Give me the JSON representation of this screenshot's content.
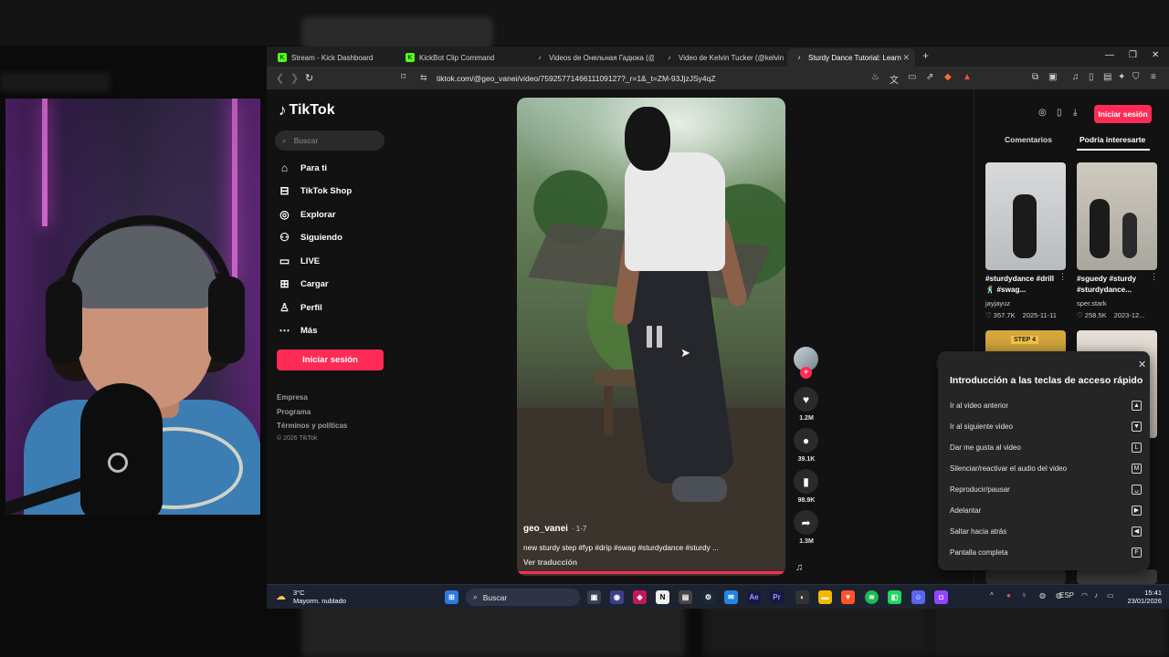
{
  "browser": {
    "tabs": [
      {
        "label": "Stream - Kick Dashboard",
        "icon": "kick-icon",
        "color": "#53fc18"
      },
      {
        "label": "KickBot Clip Command",
        "icon": "kick-icon",
        "color": "#53fc18"
      },
      {
        "label": "Videos de Онельная Гадюка (@gora",
        "icon": "tiktok-icon",
        "color": "#ffffff"
      },
      {
        "label": "Video de Kelvin Tucker (@kelvinkelvi",
        "icon": "tiktok-icon",
        "color": "#ffffff"
      },
      {
        "label": "Sturdy Dance Tutorial: Learn",
        "icon": "tiktok-icon",
        "color": "#ffffff",
        "active": true
      }
    ],
    "url": "tiktok.com/@geo_vanei/video/7592577146611109127?_r=1&_t=ZM-93JjzJSy4qZ"
  },
  "tiktok": {
    "logo_text": "TikTok",
    "search_placeholder": "Buscar",
    "menu": [
      {
        "label": "Para ti",
        "icon": "home-icon"
      },
      {
        "label": "TikTok Shop",
        "icon": "shop-icon"
      },
      {
        "label": "Explorar",
        "icon": "compass-icon"
      },
      {
        "label": "Siguiendo",
        "icon": "following-icon"
      },
      {
        "label": "LIVE",
        "icon": "live-icon"
      },
      {
        "label": "Cargar",
        "icon": "upload-icon"
      },
      {
        "label": "Perfil",
        "icon": "profile-icon"
      },
      {
        "label": "Más",
        "icon": "more-icon"
      }
    ],
    "login_label": "Iniciar sesión",
    "footer": {
      "links": [
        "Empresa",
        "Programa",
        "Términos y políticas"
      ],
      "copyright": "© 2026 TikTok"
    },
    "accent": "#fe2c55"
  },
  "video": {
    "author": "geo_vanei",
    "date": "· 1-7",
    "description": "new sturdy step #fyp #drip #swag #sturdydance #sturdy ...",
    "translate": "Ver traducción",
    "counts": {
      "likes": "1.2M",
      "comments": "39.1K",
      "saves": "98.9K",
      "shares": "1.3M"
    }
  },
  "right_panel": {
    "login_label": "Iniciar sesión",
    "tabs": [
      "Comentarios",
      "Podría interesarte"
    ],
    "suggestions": [
      {
        "caption": "#sturdydance #drill 🕺 #swag...",
        "author": "jayjayuz",
        "likes": "♡ 357.7K",
        "date": "2025-11-11"
      },
      {
        "caption": "#sguedy #sturdy #sturdydance...",
        "author": "sper.stark",
        "likes": "♡ 258.5K",
        "date": "2023-12..."
      }
    ],
    "thumb3_tag": "STEP 4"
  },
  "shortcuts": {
    "title": "Introducción a las teclas de acceso rápido",
    "items": [
      {
        "label": "Ir al video anterior",
        "key": "▲"
      },
      {
        "label": "Ir al siguiente video",
        "key": "▼"
      },
      {
        "label": "Dar me gusta al video",
        "key": "L"
      },
      {
        "label": "Silenciar/reactivar el audio del video",
        "key": "M"
      },
      {
        "label": "Reproducir/pausar",
        "key": "␣"
      },
      {
        "label": "Adelantar",
        "key": "▶"
      },
      {
        "label": "Saltar hacia atrás",
        "key": "◀"
      },
      {
        "label": "Pantalla completa",
        "key": "F"
      }
    ]
  },
  "taskbar": {
    "temp": "3°C",
    "weather": "Mayorm. nublado",
    "search": "Buscar",
    "lang": "ESP",
    "time": "15:41",
    "date": "23/01/2026"
  }
}
